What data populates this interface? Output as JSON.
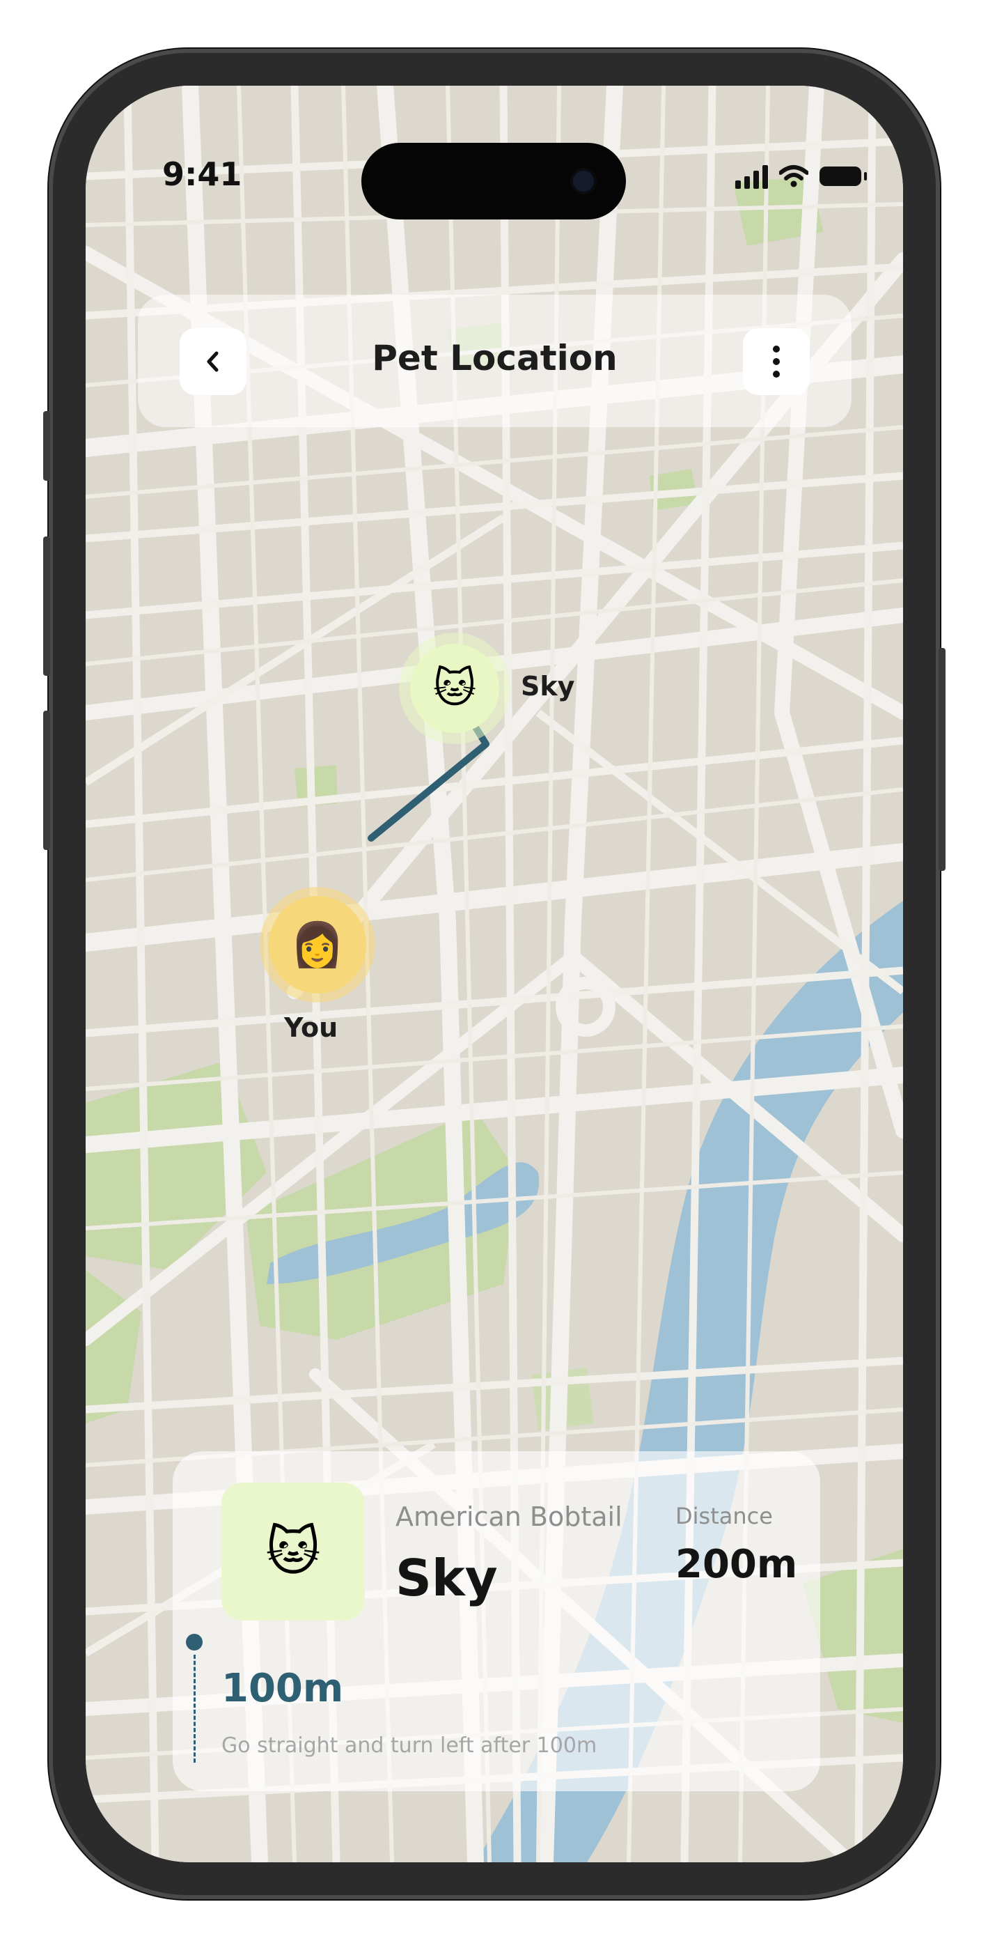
{
  "status_bar": {
    "time": "9:41"
  },
  "header": {
    "title": "Pet Location",
    "back_icon": "chevron-left-icon",
    "menu_icon": "more-vertical-icon"
  },
  "map": {
    "pet_marker": {
      "label": "Sky",
      "emoji": "🐱",
      "color": "#e8f7c4"
    },
    "user_marker": {
      "label": "You",
      "emoji": "👩",
      "color": "#f6d77a"
    },
    "route_color": "#2e5f72"
  },
  "pet_card": {
    "breed": "American Bobtail",
    "name": "Sky",
    "emoji": "🐱",
    "distance_label": "Distance",
    "distance_value": "200m",
    "next_step_distance": "100m",
    "next_step_instruction": "Go straight and turn left after 100m"
  },
  "colors": {
    "map_land": "#ddd8cd",
    "map_road": "#f2f0ec",
    "map_park": "#c7d8a9",
    "map_water": "#9ec1d6",
    "accent": "#2e5f72"
  }
}
